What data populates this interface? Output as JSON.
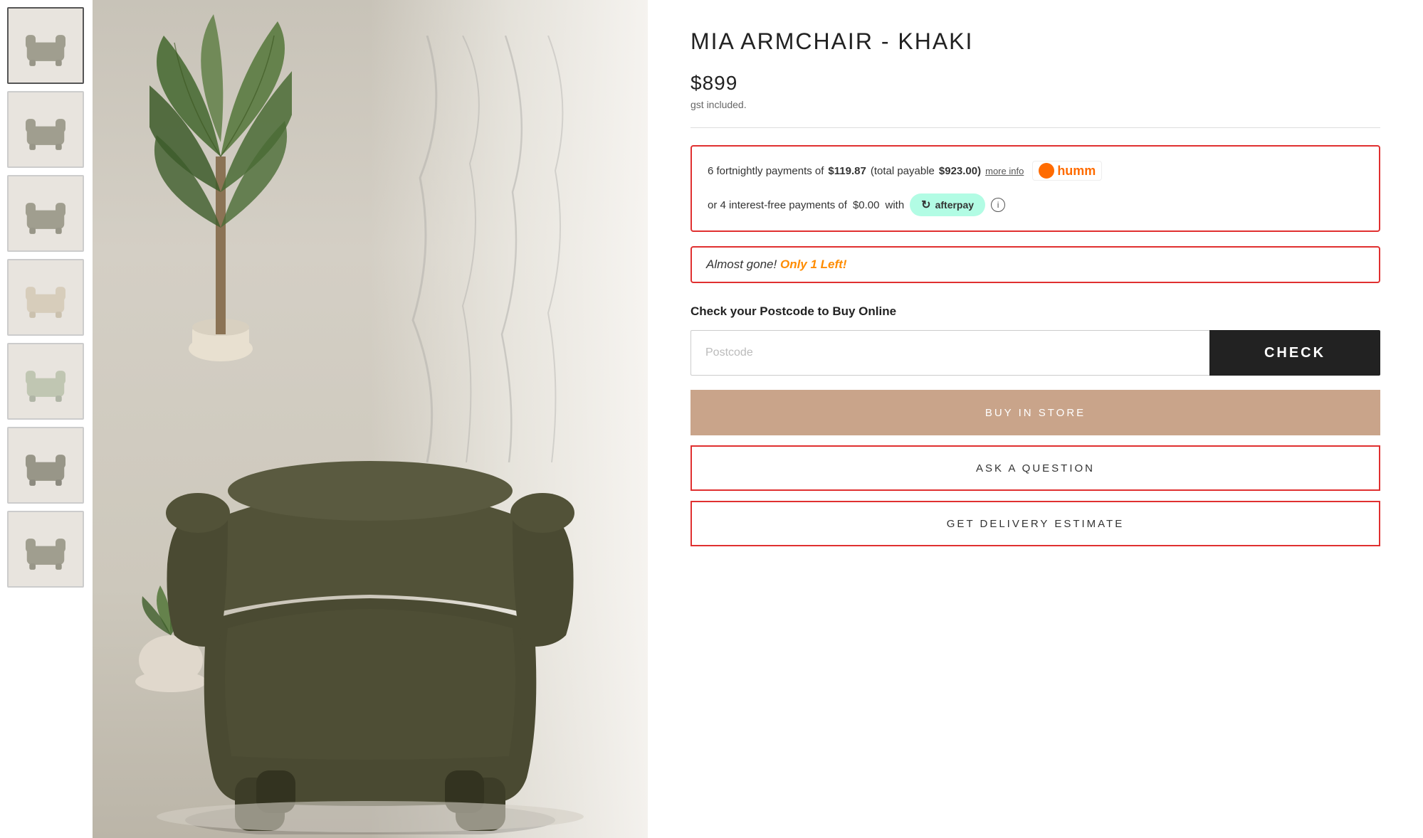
{
  "product": {
    "title": "MIA ARMCHAIR - KHAKI",
    "price": "$899",
    "gst_text": "gst included.",
    "payment": {
      "humm_installments": "6 fortnightly payments of",
      "humm_amount": "$119.87",
      "humm_total_label": "(total payable",
      "humm_total": "$923.00)",
      "more_info": "more info",
      "afterpay_intro": "or 4 interest-free payments of",
      "afterpay_amount": "$0.00",
      "afterpay_with": "with"
    },
    "stock_warning": "Almost gone!",
    "stock_count": "Only 1 Left!",
    "postcode_section": {
      "label": "Check your Postcode to Buy Online",
      "placeholder": "Postcode",
      "check_label": "CHECK"
    },
    "buttons": {
      "buy_in_store": "BUY IN STORE",
      "ask_question": "ASK A QUESTION",
      "delivery_estimate": "GET DELIVERY ESTIMATE"
    }
  },
  "thumbnails": [
    {
      "id": 1,
      "alt": "Mia Armchair front view",
      "active": true
    },
    {
      "id": 2,
      "alt": "Mia Armchair side view",
      "active": false
    },
    {
      "id": 3,
      "alt": "Mia Armchair angle view",
      "active": false
    },
    {
      "id": 4,
      "alt": "Mia Armchair beige version",
      "active": false
    },
    {
      "id": 5,
      "alt": "Mia Armchair light green",
      "active": false
    },
    {
      "id": 6,
      "alt": "Mia Armchair dark view",
      "active": false
    },
    {
      "id": 7,
      "alt": "Mia Armchair partial",
      "active": false
    }
  ],
  "colors": {
    "red_border": "#e03030",
    "check_bg": "#222222",
    "buy_bg": "#c9a48a",
    "almost_gone_orange": "#ff8c00",
    "afterpay_green": "#b2fce4"
  }
}
